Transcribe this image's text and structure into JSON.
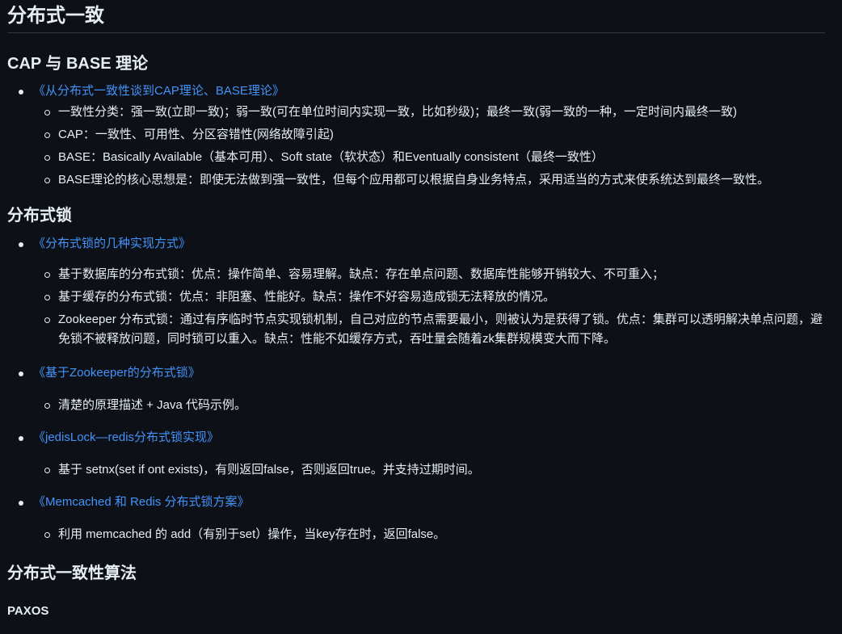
{
  "title": "分布式一致",
  "sections": [
    {
      "heading": "CAP 与 BASE 理论",
      "items": [
        {
          "link": "《从分布式一致性谈到CAP理论、BASE理论》",
          "sub": [
            "一致性分类：强一致(立即一致)；弱一致(可在单位时间内实现一致，比如秒级)；最终一致(弱一致的一种，一定时间内最终一致)",
            "CAP：一致性、可用性、分区容错性(网络故障引起)",
            "BASE：Basically Available（基本可用）、Soft state（软状态）和Eventually consistent（最终一致性）",
            "BASE理论的核心思想是：即使无法做到强一致性，但每个应用都可以根据自身业务特点，采用适当的方式来使系统达到最终一致性。"
          ]
        }
      ]
    },
    {
      "heading": "分布式锁",
      "items": [
        {
          "link": "《分布式锁的几种实现方式》",
          "sub": [
            "基于数据库的分布式锁：优点：操作简单、容易理解。缺点：存在单点问题、数据库性能够开销较大、不可重入；",
            "基于缓存的分布式锁：优点：非阻塞、性能好。缺点：操作不好容易造成锁无法释放的情况。",
            "Zookeeper 分布式锁：通过有序临时节点实现锁机制，自己对应的节点需要最小，则被认为是获得了锁。优点：集群可以透明解决单点问题，避免锁不被释放问题，同时锁可以重入。缺点：性能不如缓存方式，吞吐量会随着zk集群规模变大而下降。"
          ]
        },
        {
          "link": "《基于Zookeeper的分布式锁》",
          "sub": [
            "清楚的原理描述 + Java 代码示例。"
          ]
        },
        {
          "link": "《jedisLock—redis分布式锁实现》",
          "sub": [
            "基于 setnx(set if ont exists)，有则返回false，否则返回true。并支持过期时间。"
          ]
        },
        {
          "link": "《Memcached 和 Redis 分布式锁方案》",
          "sub": [
            "利用 memcached 的 add（有别于set）操作，当key存在时，返回false。"
          ]
        }
      ]
    },
    {
      "heading": "分布式一致性算法",
      "subheading": "PAXOS"
    }
  ]
}
